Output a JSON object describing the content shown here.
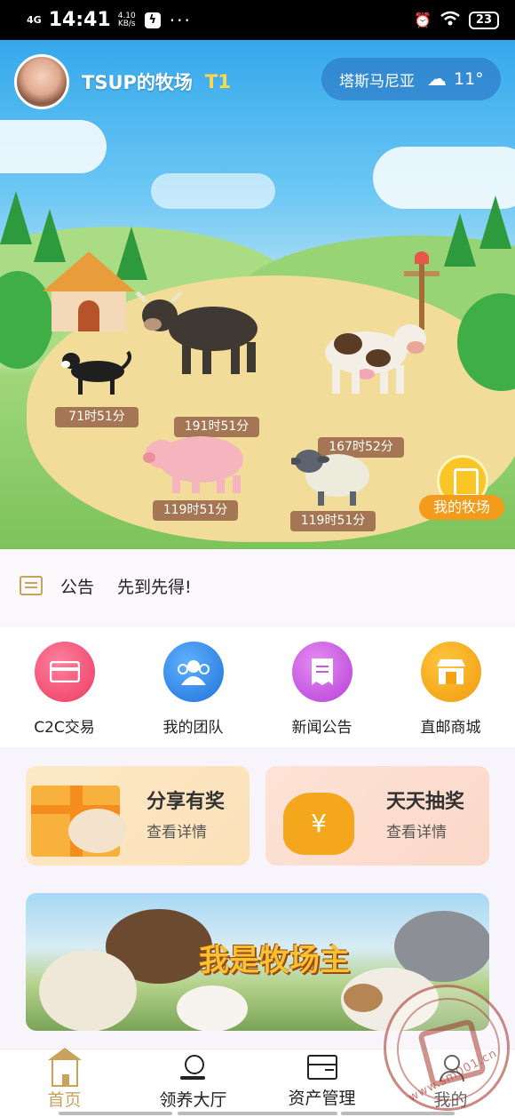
{
  "status_bar": {
    "signal": "4G",
    "time": "14:41",
    "speed_value": "4.10",
    "speed_unit": "KB/s",
    "battery": "23"
  },
  "farm": {
    "owner_name": "TSUP的牧场",
    "level": "T1",
    "weather": {
      "city": "塔斯马尼亚",
      "temperature": "11°",
      "icon": "cloud-icon"
    },
    "animals": [
      {
        "name": "dog",
        "timer": "71时51分"
      },
      {
        "name": "bull",
        "timer": "191时51分"
      },
      {
        "name": "dairy-cow",
        "timer": "167时52分"
      },
      {
        "name": "pig",
        "timer": "119时51分"
      },
      {
        "name": "sheep",
        "timer": "119时51分"
      }
    ],
    "my_ranch_label": "我的牧场"
  },
  "notice": {
    "label": "公告",
    "text": "先到先得!"
  },
  "shortcuts": [
    {
      "label": "C2C交易",
      "icon": "card-icon",
      "color": "#f0507a"
    },
    {
      "label": "我的团队",
      "icon": "team-icon",
      "color": "#2e88e8"
    },
    {
      "label": "新闻公告",
      "icon": "receipt-icon",
      "color": "#c858e0"
    },
    {
      "label": "直邮商城",
      "icon": "shop-icon",
      "color": "#f4a316"
    }
  ],
  "promos": [
    {
      "title": "分享有奖",
      "subtitle": "查看详情",
      "icon": "gift-icon"
    },
    {
      "title": "天天抽奖",
      "subtitle": "查看详情",
      "icon": "money-bag-icon"
    }
  ],
  "banner": {
    "title": "我是牧场主"
  },
  "bottom_nav": [
    {
      "label": "首页",
      "icon": "home-icon",
      "active": true
    },
    {
      "label": "领养大厅",
      "icon": "hall-icon",
      "active": false
    },
    {
      "label": "资产管理",
      "icon": "asset-icon",
      "active": false
    },
    {
      "label": "我的",
      "icon": "user-icon",
      "active": false
    }
  ],
  "watermark_text": "www.sm001.cn"
}
